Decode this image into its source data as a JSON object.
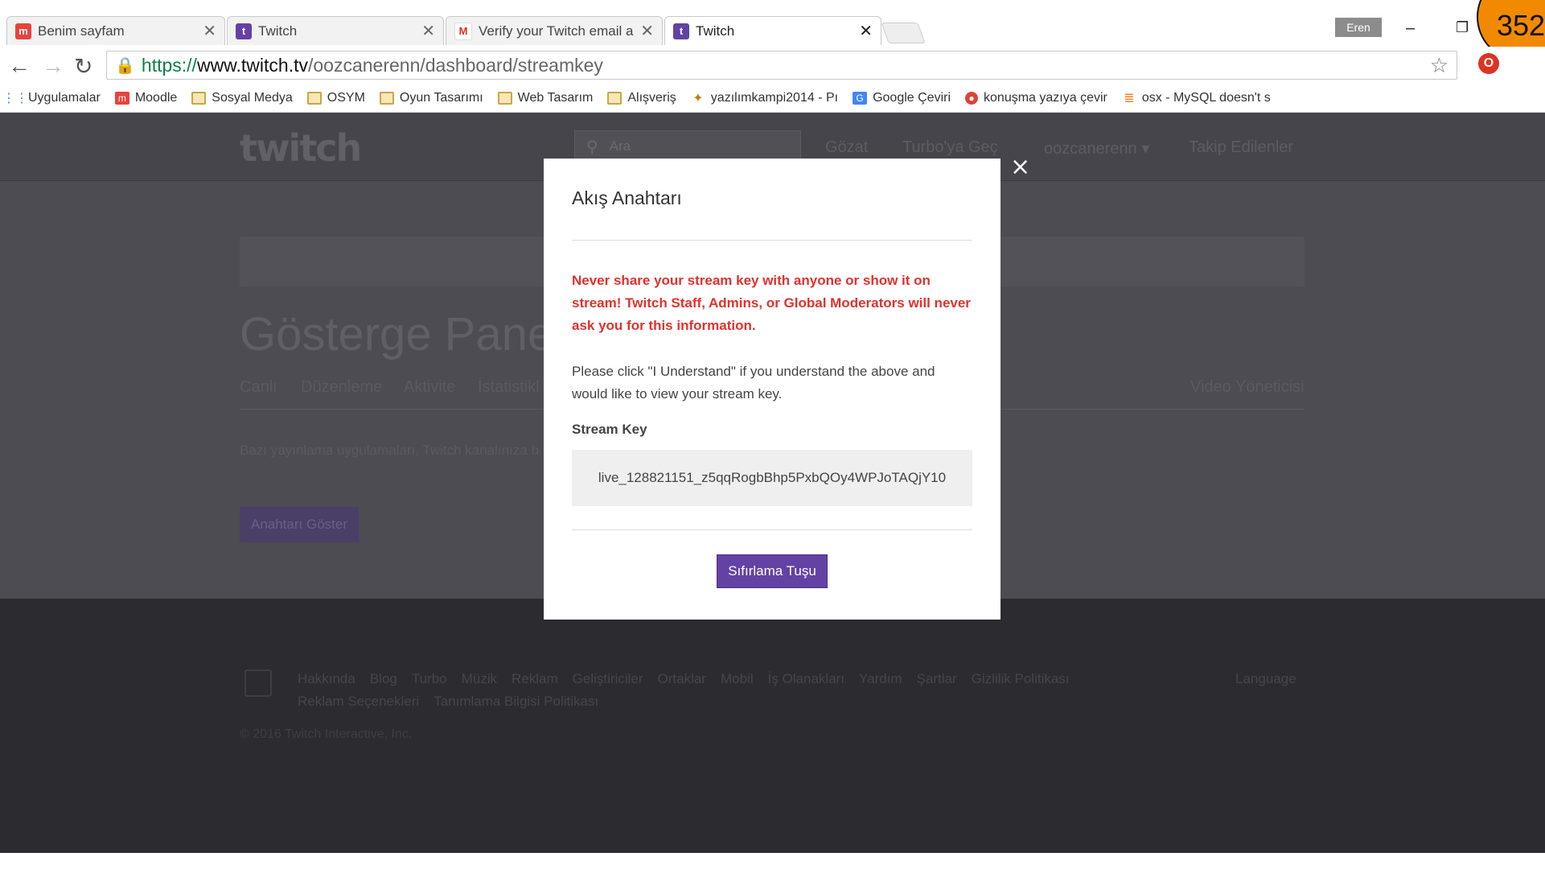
{
  "browser": {
    "tabs": [
      {
        "title": "Benim sayfam",
        "icon": "moodle-icon",
        "color": "#e8423c"
      },
      {
        "title": "Twitch",
        "icon": "twitch-icon",
        "color": "#6441a4"
      },
      {
        "title": "Verify your Twitch email a",
        "icon": "gmail-icon",
        "color": "#d93025"
      },
      {
        "title": "Twitch",
        "icon": "twitch-icon",
        "color": "#6441a4"
      }
    ],
    "user_badge": "Eren",
    "counter": "352",
    "url": {
      "protocol": "https://",
      "host": "www.twitch.tv",
      "path": "/oozcanerenn/dashboard/streamkey"
    },
    "bookmarks": [
      {
        "label": "Uygulamalar",
        "icon": "apps-grid-icon"
      },
      {
        "label": "Moodle",
        "icon": "moodle-icon"
      },
      {
        "label": "Sosyal Medya",
        "icon": "folder-icon"
      },
      {
        "label": "OSYM",
        "icon": "folder-icon"
      },
      {
        "label": "Oyun Tasarımı",
        "icon": "folder-icon"
      },
      {
        "label": "Web Tasarım",
        "icon": "folder-icon"
      },
      {
        "label": "Alışveriş",
        "icon": "folder-icon"
      },
      {
        "label": "yazılımkampi2014 - Pı",
        "icon": "kamp-icon"
      },
      {
        "label": "Google Çeviri",
        "icon": "google-translate-icon"
      },
      {
        "label": "konuşma yazıya çevir",
        "icon": "chrome-icon"
      },
      {
        "label": "osx - MySQL doesn't s",
        "icon": "stackoverflow-icon"
      }
    ]
  },
  "twitch": {
    "logo": "twitch",
    "search_placeholder": "Ara",
    "nav": {
      "browse": "Gözat",
      "turbo": "Turbo'ya Geç",
      "user": "oozcanerenn ▾",
      "following": "Takip Edilenler"
    },
    "dashboard": {
      "title": "Gösterge Pane",
      "tabs": [
        "Canlı",
        "Düzenleme",
        "Aktivite",
        "İstatistikl"
      ],
      "video_manager": "Video Yöneticisi",
      "body_text": "Bazı yayınlama uygulamaları, Twitch kanalınıza b",
      "show_key_button": "Anahtarı Göster"
    },
    "footer": {
      "links_row1": [
        "Hakkında",
        "Blog",
        "Turbo",
        "Müzik",
        "Reklam",
        "Geliştiriciler",
        "Ortaklar",
        "Mobil",
        "İş Olanakları",
        "Yardım",
        "Şartlar",
        "Gizlilik Politikası"
      ],
      "links_row2": [
        "Reklam Seçenekleri",
        "Tanımlama Bilgisi Politikası"
      ],
      "language": "Language",
      "copyright": "© 2016 Twitch Interactive, Inc."
    }
  },
  "modal": {
    "title": "Akış Anahtarı",
    "warning": "Never share your stream key with anyone or show it on stream! Twitch Staff, Admins, or Global Moderators will never ask you for this information.",
    "info": "Please click \"I Understand\" if you understand the above and would like to view your stream key.",
    "key_label": "Stream Key",
    "key_value": "live_128821151_z5qqRogbBhp5PxbQOy4WPJoTAQjY10",
    "reset_button": "Sıfırlama Tuşu",
    "close": "×"
  },
  "colors": {
    "twitch_purple": "#6441a4",
    "warning_red": "#e0322d",
    "counter_orange": "#f28a00"
  }
}
